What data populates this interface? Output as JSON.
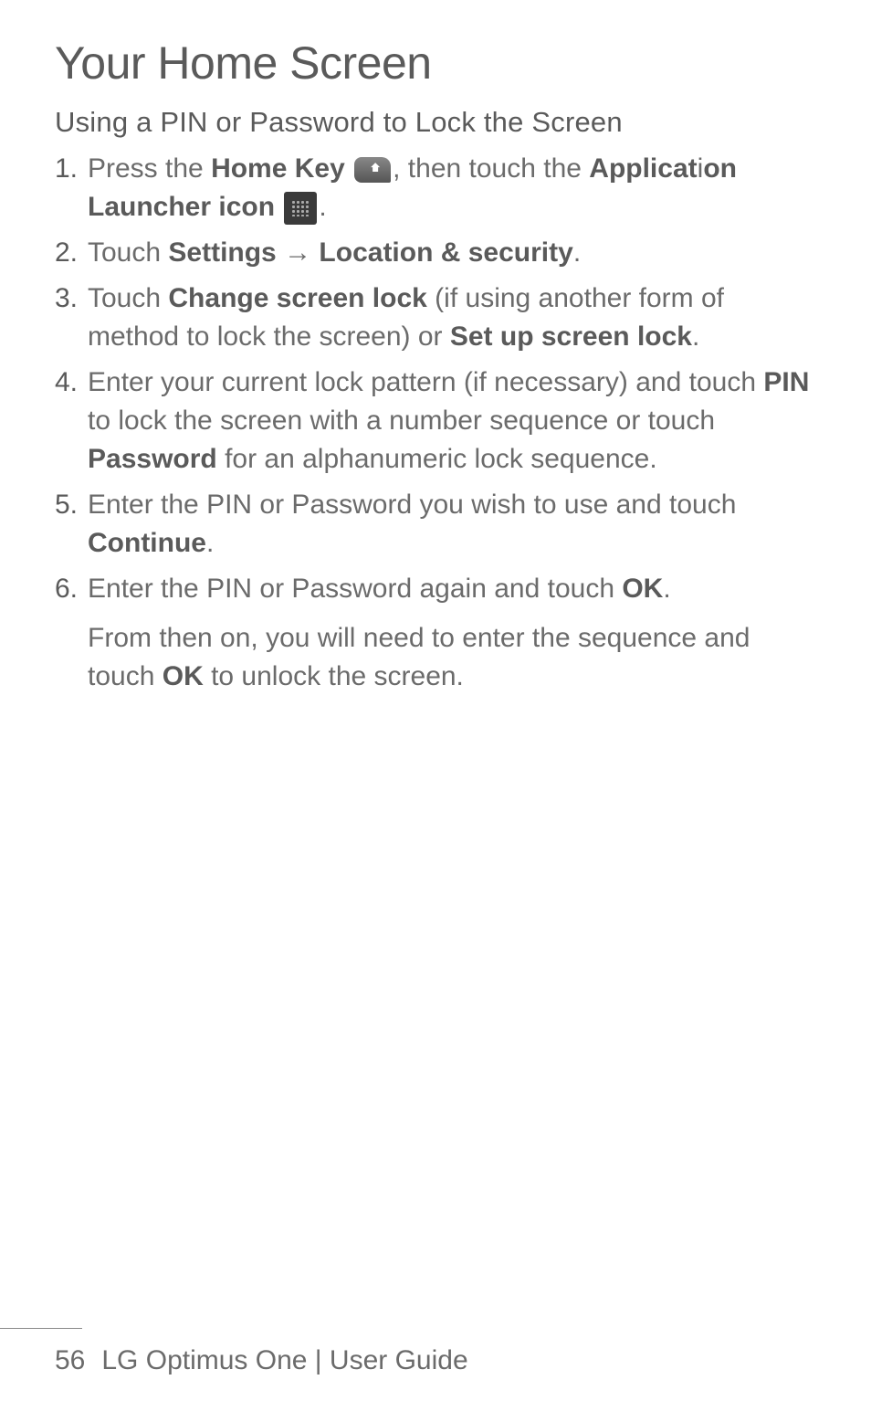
{
  "title": "Your Home Screen",
  "heading": "Using a PIN or Password to Lock the Screen",
  "steps": {
    "s1": {
      "num": "1.",
      "t1": "Press the ",
      "b1": "Home Key",
      "t2": ", then touch the ",
      "b2": "Applicat",
      "i1": "i",
      "b3": "on Launcher icon",
      "t3": "."
    },
    "s2": {
      "num": "2.",
      "t1": "Touch ",
      "b1": "Settings",
      "arrow": " → ",
      "b2": "Location & security",
      "t2": "."
    },
    "s3": {
      "num": "3.",
      "t1": "Touch ",
      "b1": "Change screen lock",
      "t2": " (if using another form of method to lock the screen) or ",
      "b2": "Set up screen lock",
      "t3": "."
    },
    "s4": {
      "num": "4.",
      "t1": "Enter your current lock pattern (if necessary) and touch ",
      "b1": "PIN",
      "t2": " to lock the screen with a number sequence or touch  ",
      "b2": "Password",
      "t3": " for an alphanumeric lock sequence."
    },
    "s5": {
      "num": "5.",
      "t1": "Enter the PIN or Password you wish to use and touch ",
      "b1": "Continue",
      "t2": "."
    },
    "s6": {
      "num": "6.",
      "t1": "Enter the PIN or Password again and touch ",
      "b1": "OK",
      "t2": ".",
      "sub1": "From then on, you will need to enter the sequence and touch ",
      "sub_b": "OK",
      "sub2": " to unlock the screen."
    }
  },
  "footer": {
    "page": "56",
    "text": "LG Optimus One  |  User Guide"
  }
}
